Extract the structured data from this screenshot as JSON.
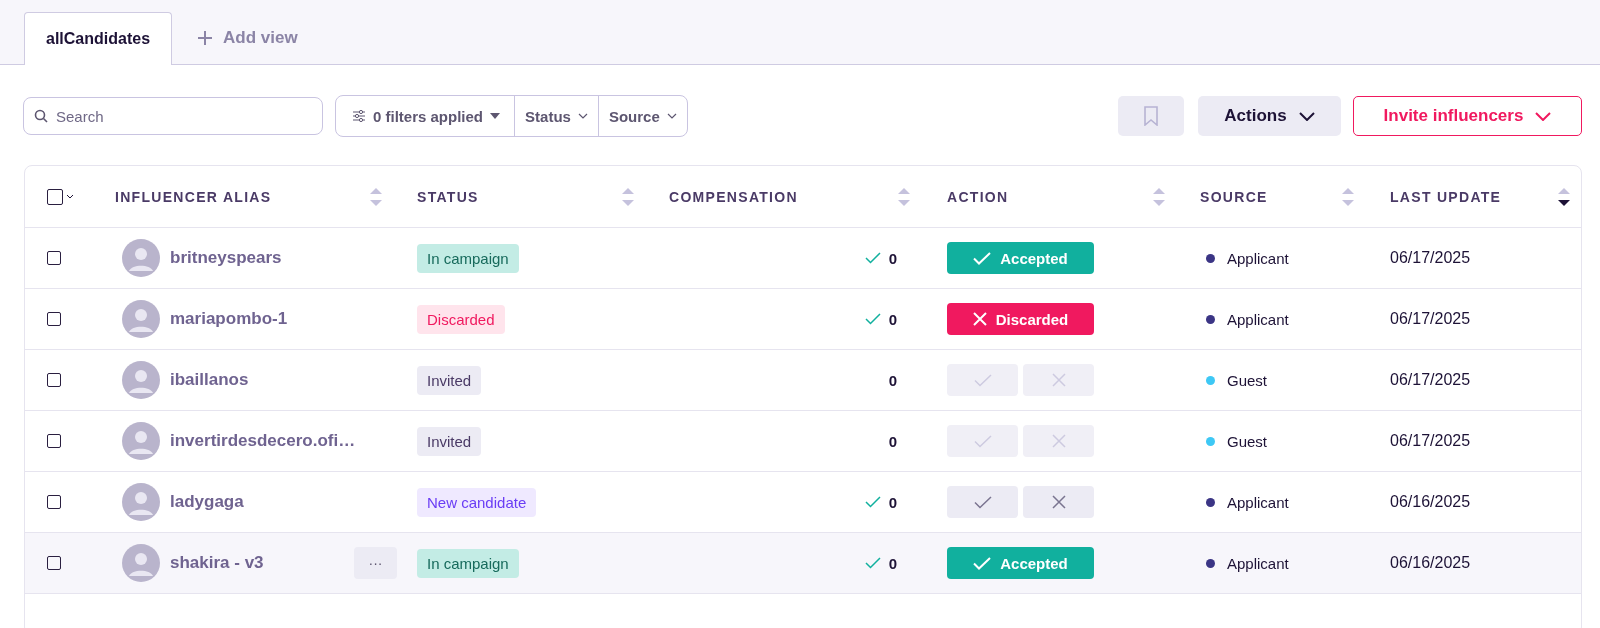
{
  "tabs": [
    {
      "label": "allCandidates",
      "selected": true
    }
  ],
  "add_view": {
    "label": "Add view"
  },
  "toolbar": {
    "search": {
      "placeholder": "Search"
    },
    "filters": {
      "label": "0 filters applied"
    },
    "dropdowns": [
      "Status",
      "Source"
    ],
    "actions": {
      "label": "Actions"
    },
    "invite": {
      "label": "Invite influencers"
    }
  },
  "table": {
    "select_all": {
      "checked": false
    },
    "columns": [
      {
        "label": "INFLUENCER ALIAS",
        "sorted_desc": false
      },
      {
        "label": "STATUS",
        "sorted_desc": false
      },
      {
        "label": "COMPENSATION",
        "sorted_desc": false
      },
      {
        "label": "ACTION",
        "sorted_desc": false
      },
      {
        "label": "SOURCE",
        "sorted_desc": false
      },
      {
        "label": "LAST UPDATE",
        "sorted_desc": true
      }
    ],
    "rows": [
      {
        "checked": false,
        "hovered": false,
        "alias": "britneyspears",
        "status": {
          "label": "In campaign",
          "kind": "campaign"
        },
        "compensation": {
          "confirmed": true,
          "value": "0"
        },
        "action": {
          "kind": "accepted",
          "label": "Accepted"
        },
        "source": {
          "label": "Applicant",
          "color": "#3b3585"
        },
        "last_update": "06/17/2025"
      },
      {
        "checked": false,
        "hovered": false,
        "alias": "mariapombo-1",
        "status": {
          "label": "Discarded",
          "kind": "discarded"
        },
        "compensation": {
          "confirmed": true,
          "value": "0"
        },
        "action": {
          "kind": "discarded",
          "label": "Discarded"
        },
        "source": {
          "label": "Applicant",
          "color": "#3b3585"
        },
        "last_update": "06/17/2025"
      },
      {
        "checked": false,
        "hovered": false,
        "alias": "ibaillanos",
        "status": {
          "label": "Invited",
          "kind": "invited"
        },
        "compensation": {
          "confirmed": false,
          "value": "0"
        },
        "action": {
          "kind": "pending",
          "disabled": true
        },
        "source": {
          "label": "Guest",
          "color": "#3ec8f5"
        },
        "last_update": "06/17/2025"
      },
      {
        "checked": false,
        "hovered": false,
        "alias": "invertirdesdecero.ofi…",
        "status": {
          "label": "Invited",
          "kind": "invited"
        },
        "compensation": {
          "confirmed": false,
          "value": "0"
        },
        "action": {
          "kind": "pending",
          "disabled": true
        },
        "source": {
          "label": "Guest",
          "color": "#3ec8f5"
        },
        "last_update": "06/17/2025"
      },
      {
        "checked": false,
        "hovered": false,
        "alias": "ladygaga",
        "status": {
          "label": "New candidate",
          "kind": "new"
        },
        "compensation": {
          "confirmed": true,
          "value": "0"
        },
        "action": {
          "kind": "pending",
          "disabled": false
        },
        "source": {
          "label": "Applicant",
          "color": "#3b3585"
        },
        "last_update": "06/16/2025"
      },
      {
        "checked": false,
        "hovered": true,
        "more": "···",
        "alias": "shakira - v3",
        "status": {
          "label": "In campaign",
          "kind": "campaign"
        },
        "compensation": {
          "confirmed": true,
          "value": "0"
        },
        "action": {
          "kind": "accepted",
          "label": "Accepted"
        },
        "source": {
          "label": "Applicant",
          "color": "#3b3585"
        },
        "last_update": "06/16/2025"
      }
    ]
  }
}
